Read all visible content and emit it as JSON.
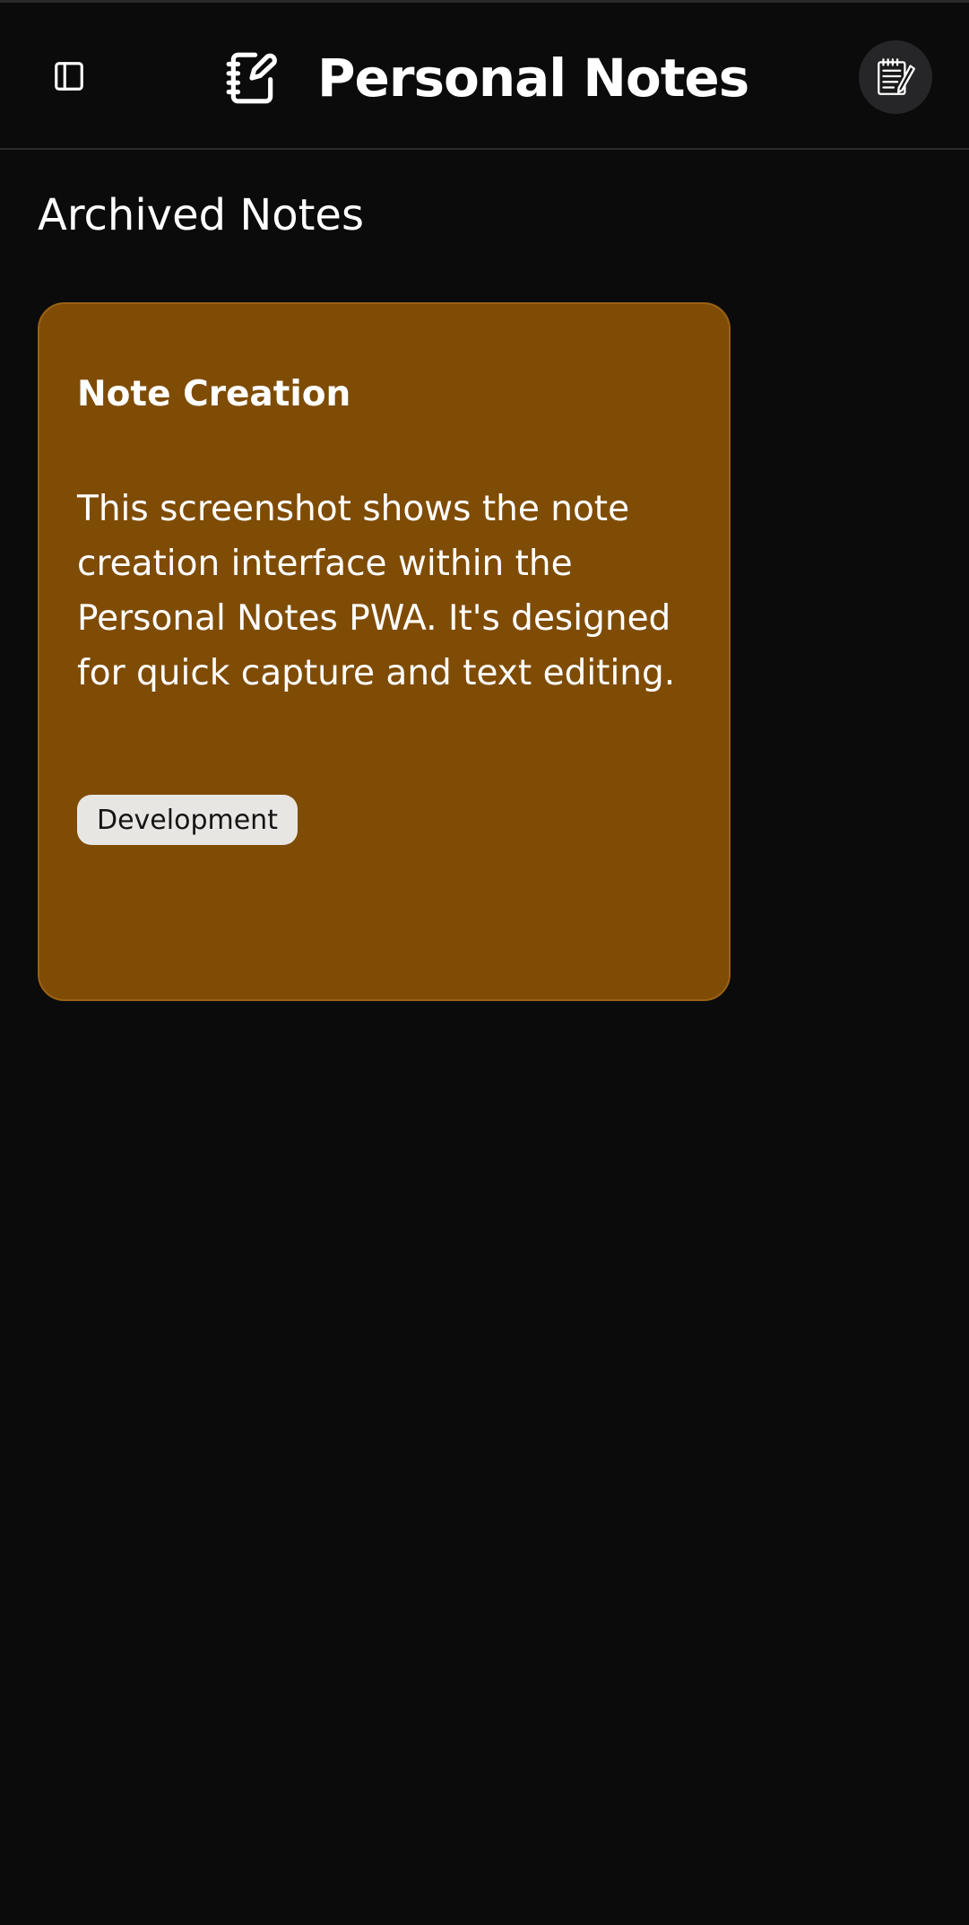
{
  "header": {
    "sidebar_toggle_icon": "sidebar-panel-icon",
    "brand_icon": "notebook-pen-icon",
    "title": "Personal Notes",
    "avatar_icon": "notepad-pencil-icon"
  },
  "main": {
    "page_title": "Archived Notes",
    "notes": [
      {
        "title": "Note Creation",
        "body": "This screenshot shows the note creation interface within the Personal Notes PWA. It's designed for quick capture and text editing.",
        "tag": "Development",
        "color": "#7f4c06"
      }
    ]
  },
  "colors": {
    "background": "#0b0b0c",
    "card": "#7f4c06",
    "tag_bg": "#e8e6e3"
  }
}
